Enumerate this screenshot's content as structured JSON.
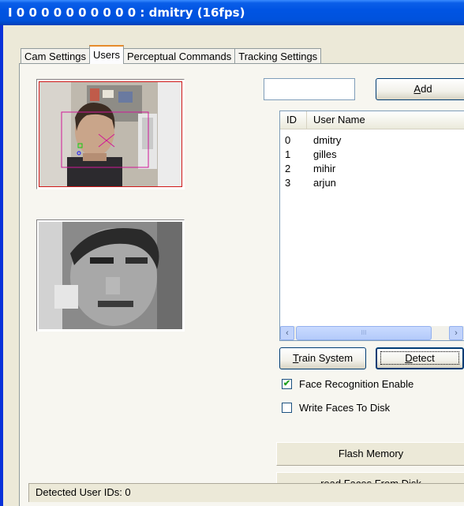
{
  "window": {
    "title": "I 0 0 0 0 0 0 0 0 0 0 : dmitry (16fps)"
  },
  "tabs": [
    {
      "label": "Cam Settings"
    },
    {
      "label": "Users"
    },
    {
      "label": "Perceptual Commands"
    },
    {
      "label": "Tracking Settings"
    }
  ],
  "active_tab": "Users",
  "user_input": {
    "value": "",
    "placeholder": ""
  },
  "buttons": {
    "add": "Add",
    "add_mnemonic": "A",
    "add_rest": "dd",
    "train": "Train System",
    "train_mnemonic": "T",
    "train_rest": "rain System",
    "detect": "Detect",
    "detect_mnemonic": "D",
    "detect_rest": "etect",
    "flash": "Flash Memory",
    "read_faces": "read Faces From Disk"
  },
  "user_list": {
    "columns": [
      "ID",
      "User Name"
    ],
    "rows": [
      {
        "id": "0",
        "name": "dmitry"
      },
      {
        "id": "1",
        "name": "gilles"
      },
      {
        "id": "2",
        "name": "mihir"
      },
      {
        "id": "3",
        "name": "arjun"
      }
    ],
    "scroll_thumb_grip": "III"
  },
  "checkboxes": {
    "face_recognition": {
      "label": "Face Recognition Enable",
      "checked": true,
      "mark": "✔"
    },
    "write_faces": {
      "label": "Write Faces To Disk",
      "checked": false,
      "mark": ""
    }
  },
  "status_bar": {
    "text": "Detected User IDs: 0"
  },
  "icons": {
    "scroll_left": "‹",
    "scroll_right": "›"
  }
}
